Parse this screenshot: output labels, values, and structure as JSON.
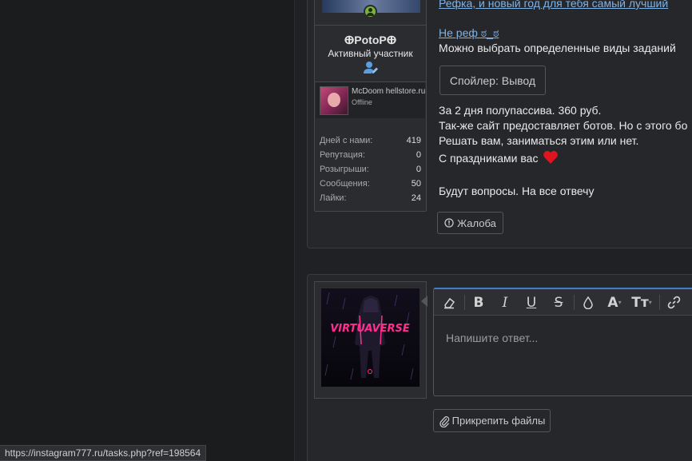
{
  "user": {
    "name": "ⴲPotoPⴲ",
    "title": "Активный участник",
    "mini_name": "McDoom hellstore.ru",
    "mini_status": "Offline",
    "stats": [
      {
        "label": "Дней с нами:",
        "value": "419"
      },
      {
        "label": "Репутация:",
        "value": "0"
      },
      {
        "label": "Розыгрыши:",
        "value": "0"
      },
      {
        "label": "Сообщения:",
        "value": "50"
      },
      {
        "label": "Лайки:",
        "value": "24"
      }
    ]
  },
  "post": {
    "line_top": "Рефка, и новый год для тебя самый лучший",
    "link": "Не реф ಠ_ಠ",
    "line1": "Можно выбрать определенные виды заданий",
    "spoiler_label": "Спойлер: Вывод",
    "line2": "За 2 дня полупассива. 360 руб.",
    "line3": "Так-же сайт предоставляет ботов. Но с этого бо",
    "line4": "Решать вам, заниматься этим или нет.",
    "line5": "С праздниками вас",
    "line6": "Будут вопросы. На все отвечу",
    "report_label": "Жалоба"
  },
  "reply": {
    "avatar_text": "VIRTUAVERSE",
    "placeholder": "Напишите ответ...",
    "attach_label": "Прикрепить файлы"
  },
  "toolbar_icons": [
    "eraser-icon",
    "bold-icon",
    "italic-icon",
    "underline-icon",
    "strikethrough-icon",
    "color-drop-icon",
    "font-color-icon",
    "font-size-icon",
    "link-icon"
  ],
  "status_url": "https://instagram777.ru/tasks.php?ref=198564",
  "colors": {
    "accent": "#3d7ec6",
    "link": "#7fb3e6",
    "online": "#7ab338",
    "heart": "#e0141e"
  }
}
